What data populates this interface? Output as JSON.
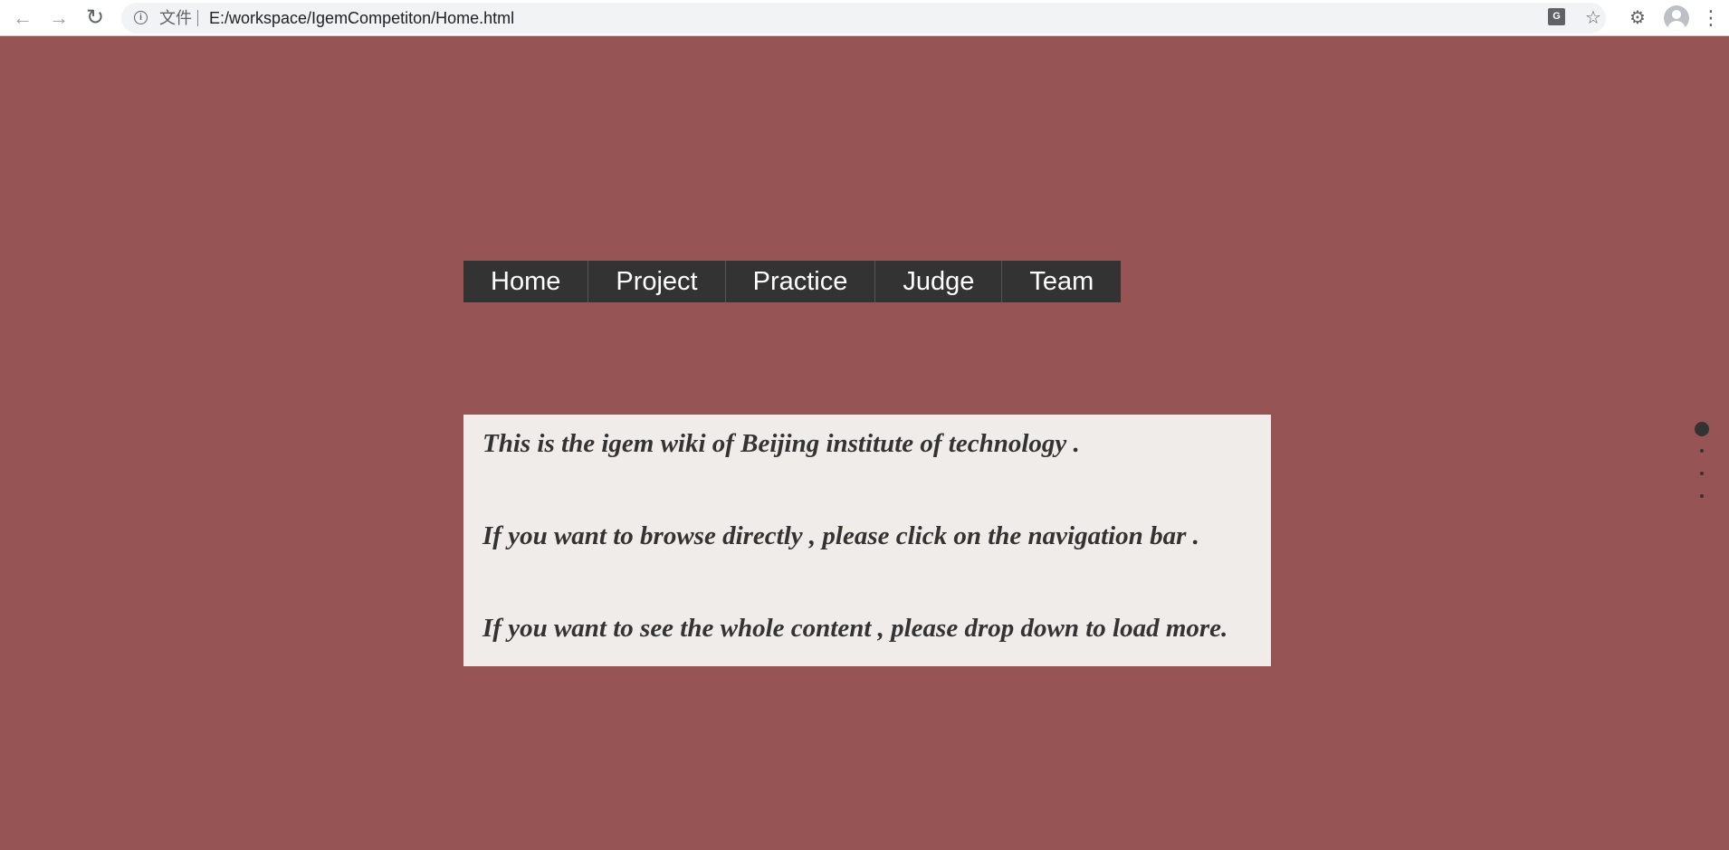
{
  "browser": {
    "back_icon": "arrow-left-icon",
    "forward_icon": "arrow-right-icon",
    "reload_icon": "reload-icon",
    "info_icon": "info-icon",
    "file_label": "文件",
    "url": "E:/workspace/IgemCompetiton/Home.html",
    "toolbar_icons": [
      "translate-icon",
      "star-icon",
      "extensions-icon",
      "profile-avatar",
      "menu-dots-icon"
    ]
  },
  "nav": {
    "items": [
      {
        "label": "Home"
      },
      {
        "label": "Project"
      },
      {
        "label": "Practice"
      },
      {
        "label": "Judge"
      },
      {
        "label": "Team"
      }
    ]
  },
  "intro": {
    "lines": [
      "This is the igem wiki of Beijing institute of technology .",
      "If you want to browse directly , please click on the navigation bar .",
      "If you want to see the whole content , please drop down to load more."
    ]
  },
  "page_indicator": {
    "total": 4,
    "active": 1
  },
  "colors": {
    "page_background": "#965454",
    "nav_background": "#333333",
    "nav_text": "#ffffff",
    "intro_background": "#f0ece9",
    "intro_text": "#333333"
  }
}
